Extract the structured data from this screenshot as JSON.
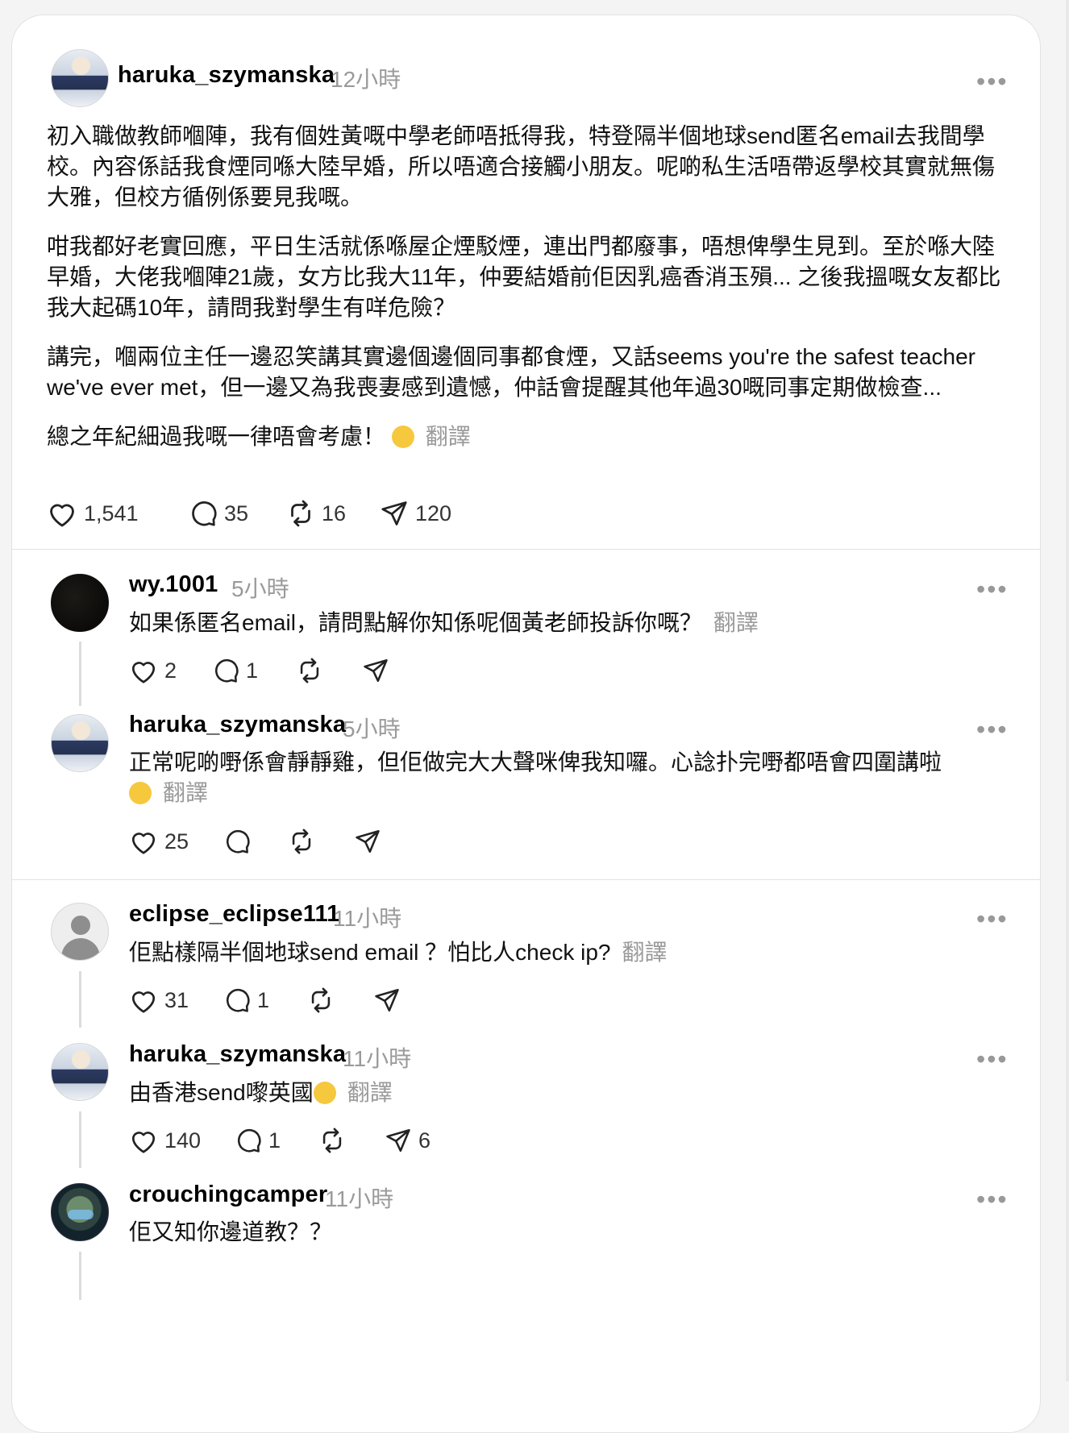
{
  "post": {
    "username": "haruka_szymanska",
    "time": "12小時",
    "paragraphs": [
      "初入職做教師嗰陣，我有個姓黃嘅中學老師唔抵得我，特登隔半個地球send匿名email去我間學校。內容係話我食煙同喺大陸早婚，所以唔適合接觸小朋友。呢啲私生活唔帶返學校其實就無傷大雅，但校方循例係要見我嘅。",
      "咁我都好老實回應，平日生活就係喺屋企煙駁煙，連出門都廢事，唔想俾學生見到。至於喺大陸早婚，大佬我嗰陣21歲，女方比我大11年，仲要結婚前佢因乳癌香消玉殞... 之後我搵嘅女友都比我大起碼10年，請問我對學生有咩危險？",
      "講完，嗰兩位主任一邊忍笑講其實邊個邊個同事都食煙，又話seems you're the safest teacher we've ever met，但一邊又為我喪妻感到遺憾，仲話會提醒其他年過30嘅同事定期做檢查...",
      "總之年紀細過我嘅一律唔會考慮！"
    ],
    "translate": "翻譯",
    "likes": "1,541",
    "comments": "35",
    "reposts": "16",
    "shares": "120"
  },
  "replies": [
    {
      "username": "wy.1001",
      "time": "5小時",
      "text": "如果係匿名email，請問點解你知係呢個黃老師投訴你嘅？",
      "translate": "翻譯",
      "likes": "2",
      "comments": "1",
      "reposts": "",
      "shares": ""
    },
    {
      "username": "haruka_szymanska",
      "time": "5小時",
      "text": "正常呢啲嘢係會靜靜雞，但佢做完大大聲咪俾我知囉。心諗扑完嘢都唔會四圍講啦",
      "translate": "翻譯",
      "likes": "25",
      "comments": "",
      "reposts": "",
      "shares": ""
    },
    {
      "username": "eclipse_eclipse111",
      "time": "11小時",
      "text": "佢點樣隔半個地球send email ？怕比人check ip?",
      "translate": "翻譯",
      "likes": "31",
      "comments": "1",
      "reposts": "",
      "shares": ""
    },
    {
      "username": "haruka_szymanska",
      "time": "11小時",
      "text": "由香港send嚟英國",
      "translate": "翻譯",
      "likes": "140",
      "comments": "1",
      "reposts": "",
      "shares": "6"
    },
    {
      "username": "crouchingcamper",
      "time": "11小時",
      "text": "佢又知你邊道教？？"
    }
  ],
  "icons": [
    "heart-icon",
    "comment-icon",
    "repost-icon",
    "share-icon",
    "more-icon"
  ]
}
